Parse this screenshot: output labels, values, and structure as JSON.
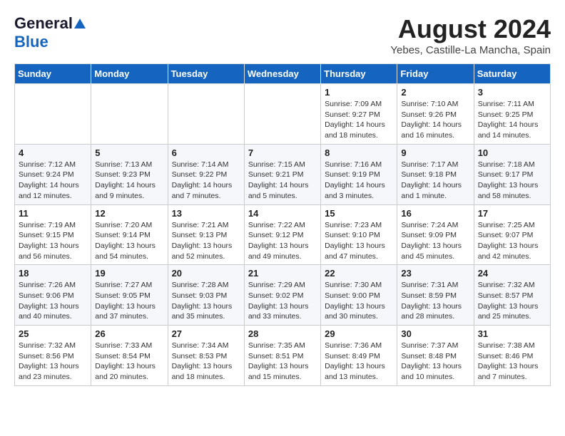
{
  "logo": {
    "general": "General",
    "blue": "Blue"
  },
  "title": "August 2024",
  "subtitle": "Yebes, Castille-La Mancha, Spain",
  "days_of_week": [
    "Sunday",
    "Monday",
    "Tuesday",
    "Wednesday",
    "Thursday",
    "Friday",
    "Saturday"
  ],
  "weeks": [
    [
      {
        "day": "",
        "info": ""
      },
      {
        "day": "",
        "info": ""
      },
      {
        "day": "",
        "info": ""
      },
      {
        "day": "",
        "info": ""
      },
      {
        "day": "1",
        "info": "Sunrise: 7:09 AM\nSunset: 9:27 PM\nDaylight: 14 hours\nand 18 minutes."
      },
      {
        "day": "2",
        "info": "Sunrise: 7:10 AM\nSunset: 9:26 PM\nDaylight: 14 hours\nand 16 minutes."
      },
      {
        "day": "3",
        "info": "Sunrise: 7:11 AM\nSunset: 9:25 PM\nDaylight: 14 hours\nand 14 minutes."
      }
    ],
    [
      {
        "day": "4",
        "info": "Sunrise: 7:12 AM\nSunset: 9:24 PM\nDaylight: 14 hours\nand 12 minutes."
      },
      {
        "day": "5",
        "info": "Sunrise: 7:13 AM\nSunset: 9:23 PM\nDaylight: 14 hours\nand 9 minutes."
      },
      {
        "day": "6",
        "info": "Sunrise: 7:14 AM\nSunset: 9:22 PM\nDaylight: 14 hours\nand 7 minutes."
      },
      {
        "day": "7",
        "info": "Sunrise: 7:15 AM\nSunset: 9:21 PM\nDaylight: 14 hours\nand 5 minutes."
      },
      {
        "day": "8",
        "info": "Sunrise: 7:16 AM\nSunset: 9:19 PM\nDaylight: 14 hours\nand 3 minutes."
      },
      {
        "day": "9",
        "info": "Sunrise: 7:17 AM\nSunset: 9:18 PM\nDaylight: 14 hours\nand 1 minute."
      },
      {
        "day": "10",
        "info": "Sunrise: 7:18 AM\nSunset: 9:17 PM\nDaylight: 13 hours\nand 58 minutes."
      }
    ],
    [
      {
        "day": "11",
        "info": "Sunrise: 7:19 AM\nSunset: 9:15 PM\nDaylight: 13 hours\nand 56 minutes."
      },
      {
        "day": "12",
        "info": "Sunrise: 7:20 AM\nSunset: 9:14 PM\nDaylight: 13 hours\nand 54 minutes."
      },
      {
        "day": "13",
        "info": "Sunrise: 7:21 AM\nSunset: 9:13 PM\nDaylight: 13 hours\nand 52 minutes."
      },
      {
        "day": "14",
        "info": "Sunrise: 7:22 AM\nSunset: 9:12 PM\nDaylight: 13 hours\nand 49 minutes."
      },
      {
        "day": "15",
        "info": "Sunrise: 7:23 AM\nSunset: 9:10 PM\nDaylight: 13 hours\nand 47 minutes."
      },
      {
        "day": "16",
        "info": "Sunrise: 7:24 AM\nSunset: 9:09 PM\nDaylight: 13 hours\nand 45 minutes."
      },
      {
        "day": "17",
        "info": "Sunrise: 7:25 AM\nSunset: 9:07 PM\nDaylight: 13 hours\nand 42 minutes."
      }
    ],
    [
      {
        "day": "18",
        "info": "Sunrise: 7:26 AM\nSunset: 9:06 PM\nDaylight: 13 hours\nand 40 minutes."
      },
      {
        "day": "19",
        "info": "Sunrise: 7:27 AM\nSunset: 9:05 PM\nDaylight: 13 hours\nand 37 minutes."
      },
      {
        "day": "20",
        "info": "Sunrise: 7:28 AM\nSunset: 9:03 PM\nDaylight: 13 hours\nand 35 minutes."
      },
      {
        "day": "21",
        "info": "Sunrise: 7:29 AM\nSunset: 9:02 PM\nDaylight: 13 hours\nand 33 minutes."
      },
      {
        "day": "22",
        "info": "Sunrise: 7:30 AM\nSunset: 9:00 PM\nDaylight: 13 hours\nand 30 minutes."
      },
      {
        "day": "23",
        "info": "Sunrise: 7:31 AM\nSunset: 8:59 PM\nDaylight: 13 hours\nand 28 minutes."
      },
      {
        "day": "24",
        "info": "Sunrise: 7:32 AM\nSunset: 8:57 PM\nDaylight: 13 hours\nand 25 minutes."
      }
    ],
    [
      {
        "day": "25",
        "info": "Sunrise: 7:32 AM\nSunset: 8:56 PM\nDaylight: 13 hours\nand 23 minutes."
      },
      {
        "day": "26",
        "info": "Sunrise: 7:33 AM\nSunset: 8:54 PM\nDaylight: 13 hours\nand 20 minutes."
      },
      {
        "day": "27",
        "info": "Sunrise: 7:34 AM\nSunset: 8:53 PM\nDaylight: 13 hours\nand 18 minutes."
      },
      {
        "day": "28",
        "info": "Sunrise: 7:35 AM\nSunset: 8:51 PM\nDaylight: 13 hours\nand 15 minutes."
      },
      {
        "day": "29",
        "info": "Sunrise: 7:36 AM\nSunset: 8:49 PM\nDaylight: 13 hours\nand 13 minutes."
      },
      {
        "day": "30",
        "info": "Sunrise: 7:37 AM\nSunset: 8:48 PM\nDaylight: 13 hours\nand 10 minutes."
      },
      {
        "day": "31",
        "info": "Sunrise: 7:38 AM\nSunset: 8:46 PM\nDaylight: 13 hours\nand 7 minutes."
      }
    ]
  ]
}
